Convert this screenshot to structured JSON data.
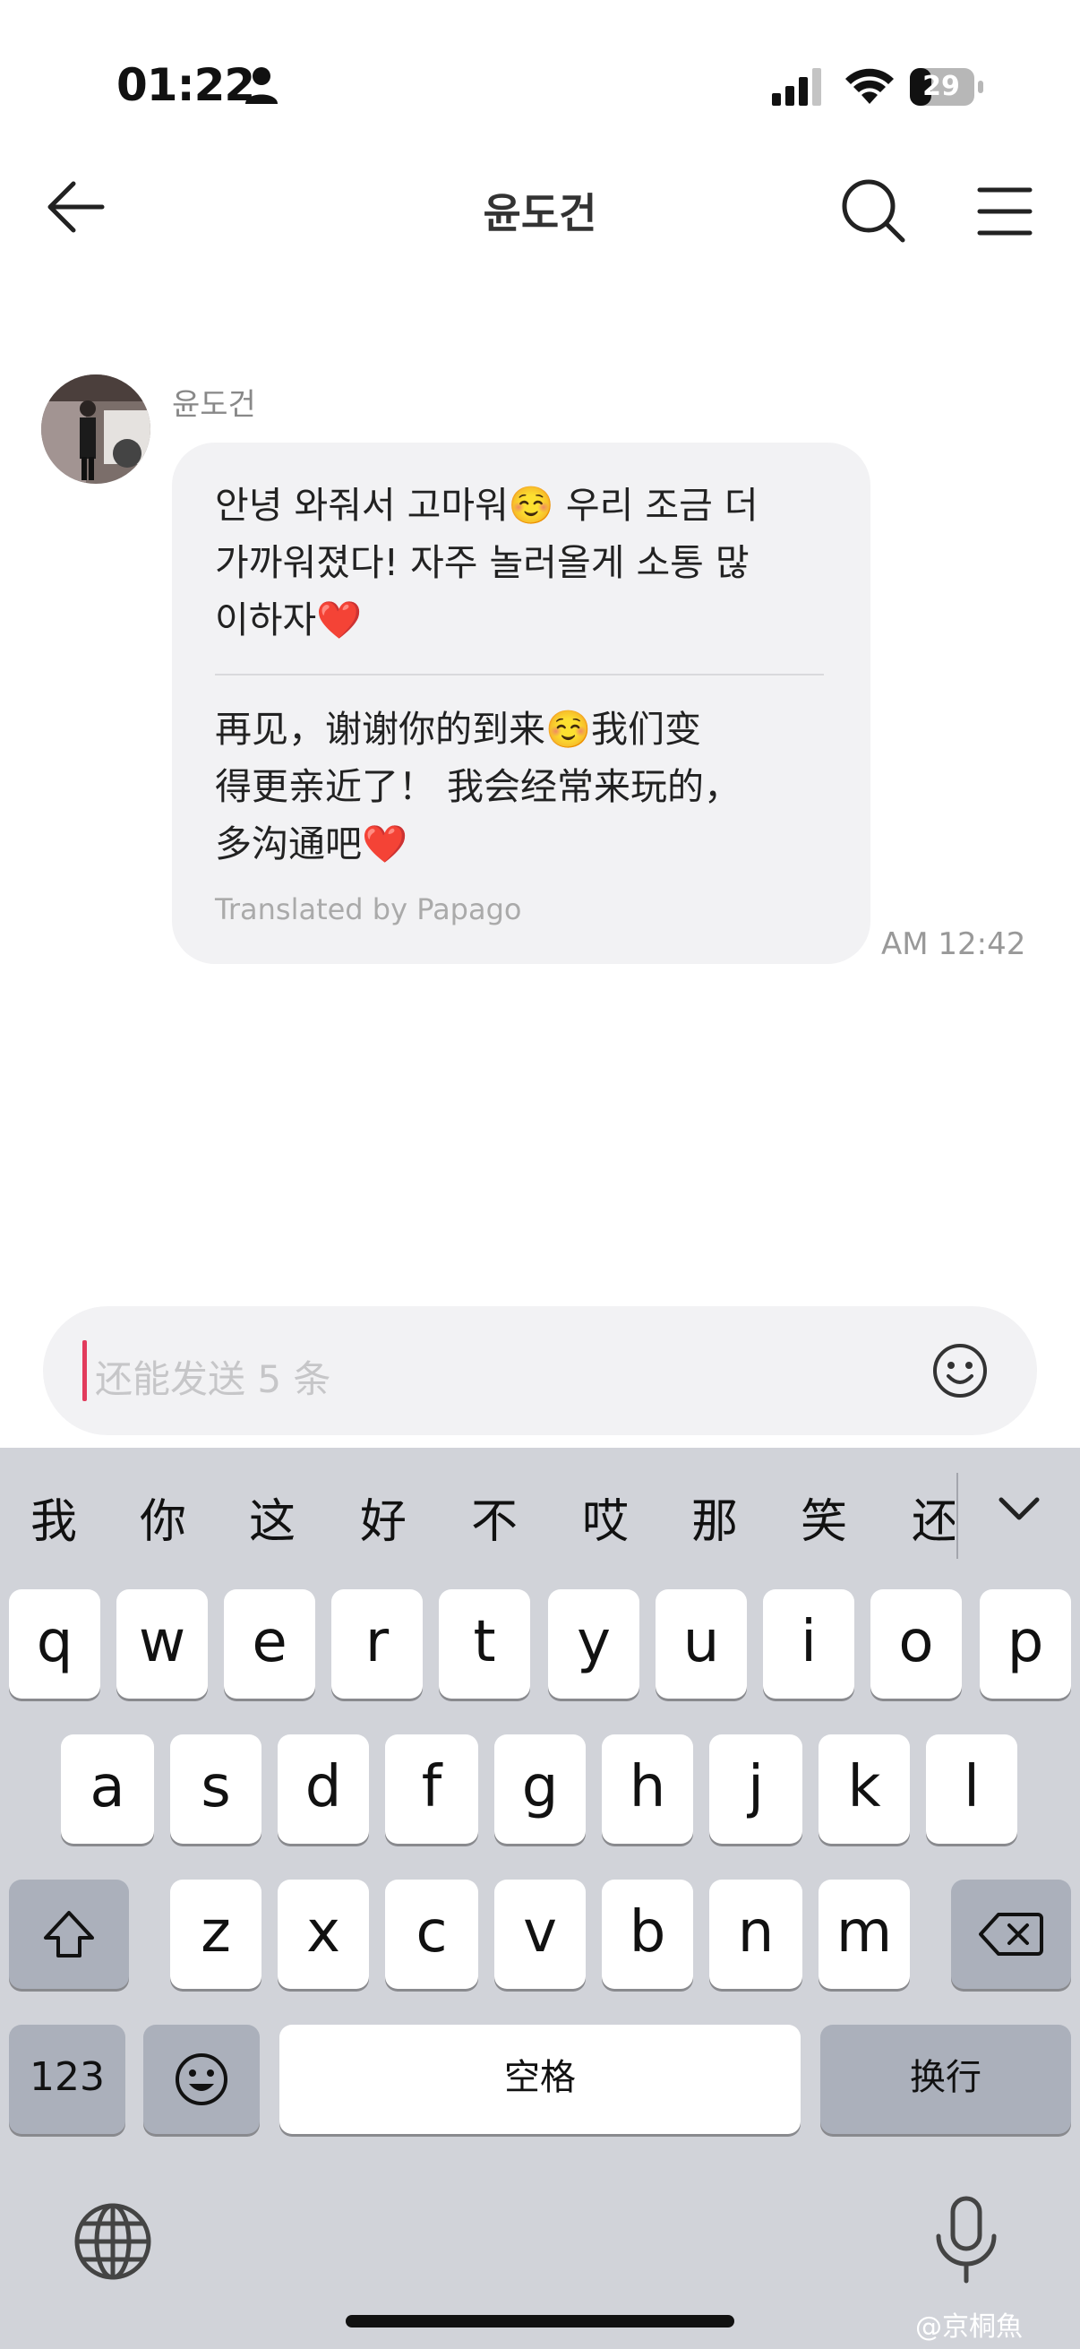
{
  "status": {
    "time": "01:22",
    "battery": "29"
  },
  "header": {
    "title": "윤도건"
  },
  "message": {
    "sender": "윤도건",
    "korean_lines": [
      "안녕 와줘서 고마워☺️ 우리 조금 더",
      "가까워졌다! 자주 놀러올게 소통 많",
      "이하자❤️"
    ],
    "chinese_lines": [
      "再见，谢谢你的到来☺️我们变",
      "得更亲近了！ 我会经常来玩的，",
      "多沟通吧❤️"
    ],
    "translated_by": "Translated by Papago",
    "time": "AM 12:42"
  },
  "composer": {
    "placeholder": "还能发送 5 条"
  },
  "keyboard": {
    "candidates": [
      "我",
      "你",
      "这",
      "好",
      "不",
      "哎",
      "那",
      "笑",
      "还"
    ],
    "row1": [
      "q",
      "w",
      "e",
      "r",
      "t",
      "y",
      "u",
      "i",
      "o",
      "p"
    ],
    "row2": [
      "a",
      "s",
      "d",
      "f",
      "g",
      "h",
      "j",
      "k",
      "l"
    ],
    "row3": [
      "z",
      "x",
      "c",
      "v",
      "b",
      "n",
      "m"
    ],
    "numbers_key": "123",
    "space_key": "空格",
    "return_key": "换行"
  },
  "watermark": "@京桐魚",
  "icons": [
    "person-icon",
    "signal-icon",
    "wifi-icon",
    "battery-icon",
    "back-arrow-icon",
    "search-icon",
    "menu-icon",
    "smiley-icon",
    "chevron-down-icon",
    "shift-icon",
    "delete-icon",
    "emoji-key-icon",
    "globe-icon",
    "microphone-icon"
  ]
}
